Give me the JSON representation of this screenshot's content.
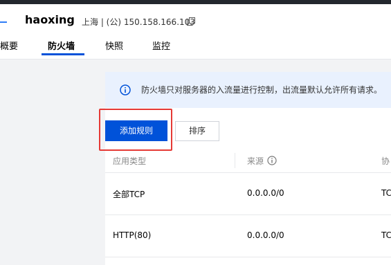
{
  "header": {
    "title": "haoxing",
    "meta": "上海 | (公) 150.158.166.103"
  },
  "tabs": [
    {
      "label": "概要"
    },
    {
      "label": "防火墙"
    },
    {
      "label": "快照"
    },
    {
      "label": "监控"
    }
  ],
  "notice": {
    "text": "防火墙只对服务器的入流量进行控制，出流量默认允许所有请求。"
  },
  "buttons": {
    "add_rule": "添加规则",
    "sort": "排序"
  },
  "table": {
    "columns": [
      "应用类型",
      "来源",
      "协"
    ],
    "rows": [
      {
        "type": "全部TCP",
        "source": "0.0.0.0/0",
        "protocol": "TC"
      },
      {
        "type": "HTTP(80)",
        "source": "0.0.0.0/0",
        "protocol": "TC"
      }
    ]
  },
  "colors": {
    "primary": "#0052d9",
    "notice_bg": "#e9f1fe",
    "highlight": "#e53935",
    "topbar": "#23272e"
  },
  "icons": {
    "copy": "copy-icon",
    "info": "info-icon",
    "help": "question-circle-icon"
  }
}
